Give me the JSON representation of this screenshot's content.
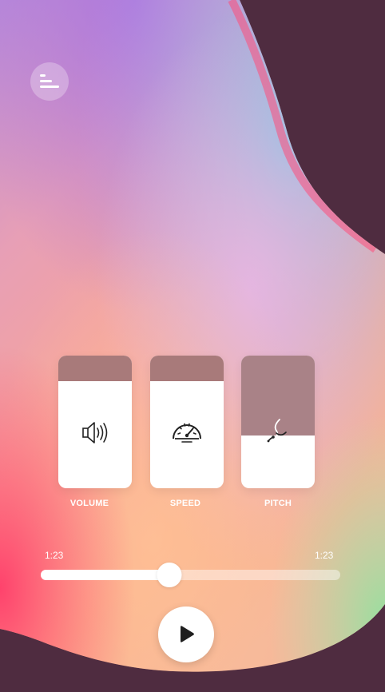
{
  "menu": {
    "icon": "menu-lines-icon"
  },
  "controls": [
    {
      "id": "volume",
      "label": "VOLUME",
      "icon": "speaker-icon",
      "level": 0.81
    },
    {
      "id": "speed",
      "label": "SPEED",
      "icon": "speedometer-icon",
      "level": 0.81
    },
    {
      "id": "pitch",
      "label": "PITCH",
      "icon": "pitch-wave-icon",
      "level": 0.4
    }
  ],
  "player": {
    "elapsed": "1:23",
    "total": "1:23",
    "progress": 0.43,
    "play_icon": "play-icon"
  },
  "colors": {
    "background": "#4f2c40",
    "card": "#ffffff",
    "card_fill": "#a87a7a",
    "text": "#ffffff"
  }
}
